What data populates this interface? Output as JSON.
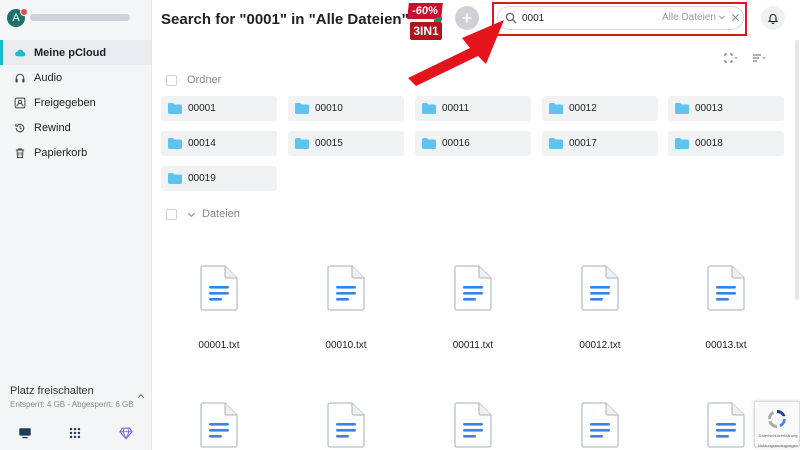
{
  "user": {
    "avatar_letter": "A"
  },
  "sidebar": {
    "items": [
      {
        "label": "Meine pCloud",
        "icon": "cloud-icon",
        "active": true
      },
      {
        "label": "Audio",
        "icon": "headphones-icon"
      },
      {
        "label": "Freigegeben",
        "icon": "shared-user-icon"
      },
      {
        "label": "Rewind",
        "icon": "rewind-icon"
      },
      {
        "label": "Papierkorb",
        "icon": "trash-icon"
      }
    ],
    "space": {
      "title": "Platz freischalten",
      "subtitle": "Entsperrt: 4 GB - Abgesperrt: 6 GB"
    },
    "bottom_icons": [
      "desktop-icon",
      "apps-grid-icon",
      "diamond-icon"
    ]
  },
  "header": {
    "title": "Search for \"0001\" in \"Alle Dateien\"",
    "promo": {
      "percent": "-60%",
      "bundle": "3IN1"
    },
    "search": {
      "value": "0001",
      "scope": "Alle Dateien"
    }
  },
  "sections": {
    "folders_label": "Ordner",
    "files_label": "Dateien"
  },
  "folders": [
    "00001",
    "00010",
    "00011",
    "00012",
    "00013",
    "00014",
    "00015",
    "00016",
    "00017",
    "00018",
    "00019"
  ],
  "files": [
    "00001.txt",
    "00010.txt",
    "00011.txt",
    "00012.txt",
    "00013.txt",
    "",
    "",
    "",
    "",
    ""
  ],
  "recaptcha": {
    "text": "Datenschutzerklärung - Nutzungsbedingungen"
  },
  "colors": {
    "accent": "#17bed0",
    "folder": "#5ec4ef",
    "doc_lines": "#3b82e6",
    "highlight": "#e5141c"
  }
}
